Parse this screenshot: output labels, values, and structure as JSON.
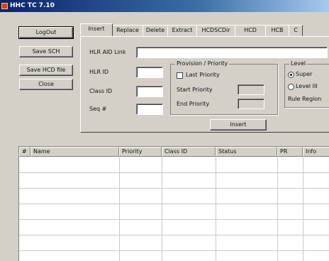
{
  "window": {
    "title": "HHC TC 7.10"
  },
  "left_buttons": [
    {
      "label": "LogOut",
      "name": "logout-button"
    },
    {
      "label": "Save SCH",
      "name": "save-sch-button"
    },
    {
      "label": "Save HCD file",
      "name": "save-hcd-button"
    },
    {
      "label": "Close",
      "name": "close-button"
    }
  ],
  "tabs": [
    "Insert",
    "Replace",
    "Delete",
    "Extract",
    "HCDSCDir",
    "HCD",
    "HCB",
    "C"
  ],
  "active_tab": "Insert",
  "form": {
    "hlr_aid_label": "HLR AID Link",
    "hlr_aid_value": "",
    "hlr_id_label": "HLR ID",
    "hlr_id_value": "",
    "class_id_label": "Class ID",
    "class_id_value": "",
    "sequence_label": "Seq #",
    "sequence_value": ""
  },
  "group_provision": {
    "legend": "Provision / Priority",
    "checkbox_label": "Last Priority",
    "checked": false,
    "start_label": "Start Priority",
    "start_value": "",
    "end_label": "End Priority",
    "end_value": ""
  },
  "group_level": {
    "legend": "Level",
    "options": [
      "Super",
      "Level III",
      "Rule Region"
    ],
    "selected": "Super"
  },
  "insert_button": "Insert",
  "grid": {
    "columns": [
      "#",
      "Name",
      "Priority",
      "Class ID",
      "Status",
      "PR",
      "Info"
    ]
  }
}
